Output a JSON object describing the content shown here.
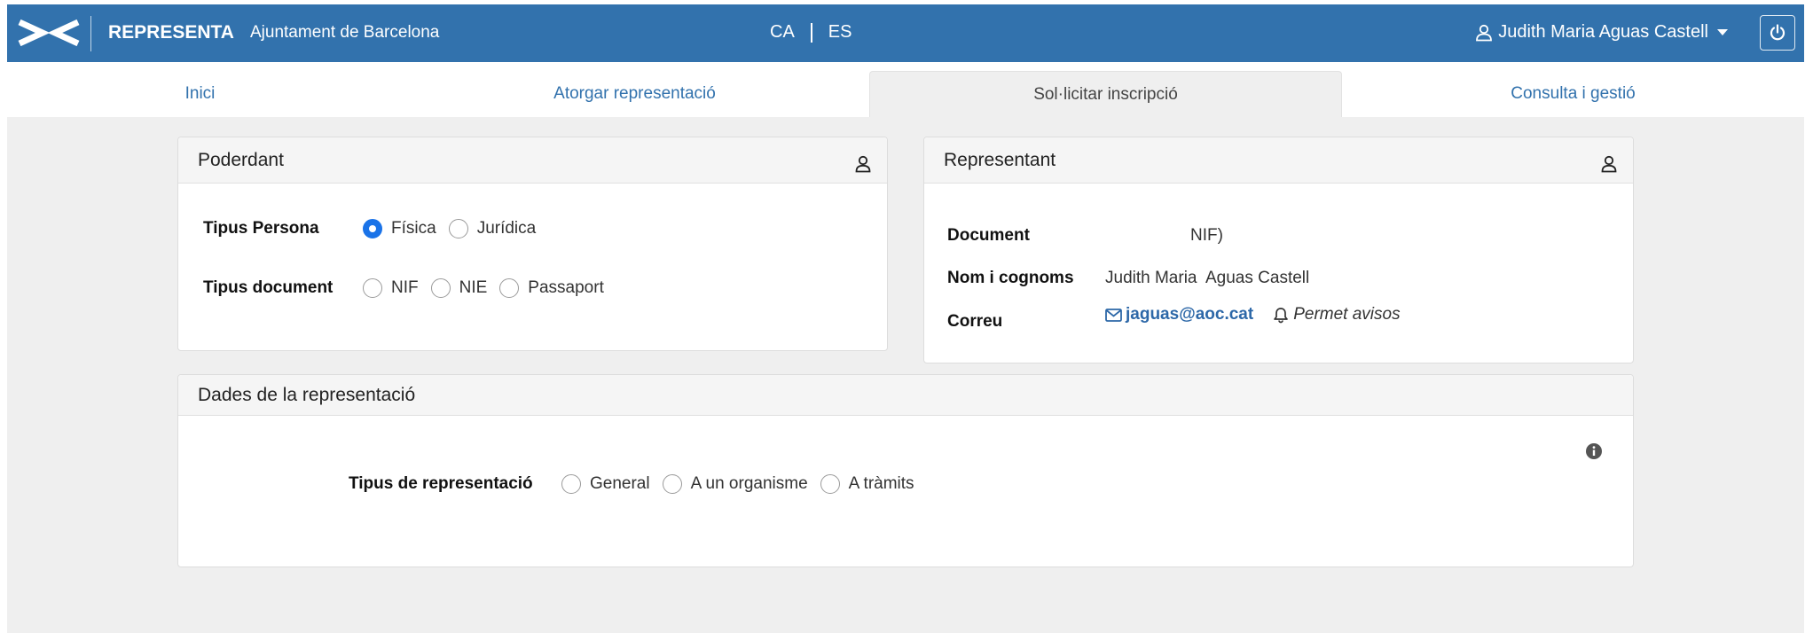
{
  "header": {
    "app_name": "REPRESENTA",
    "organization": "Ajuntament de Barcelona",
    "languages": [
      "CA",
      "ES"
    ],
    "user_name": "Judith Maria Aguas Castell"
  },
  "tabs": [
    {
      "label": "Inici"
    },
    {
      "label": "Atorgar representació"
    },
    {
      "label": "Sol·licitar inscripció"
    },
    {
      "label": "Consulta i gestió"
    }
  ],
  "poderdant": {
    "title": "Poderdant",
    "tipus_persona_label": "Tipus Persona",
    "tipus_persona_options": [
      "Física",
      "Jurídica"
    ],
    "tipus_persona_selected": "Física",
    "tipus_document_label": "Tipus document",
    "tipus_document_options": [
      "NIF",
      "NIE",
      "Passaport"
    ]
  },
  "representant": {
    "title": "Representant",
    "document_label": "Document",
    "document_value": "NIF)",
    "nom_label": "Nom i cognoms",
    "nom_value": "Judith Maria  Aguas Castell",
    "correu_label": "Correu",
    "email": "jaguas@aoc.cat",
    "permet_avisos": "Permet avisos"
  },
  "dades": {
    "title": "Dades de la representació",
    "tipus_label": "Tipus de representació",
    "tipus_options": [
      "General",
      "A un organisme",
      "A tràmits"
    ]
  },
  "colors": {
    "topbar": "#3272ad",
    "link": "#3272ad",
    "radio_checked": "#1a73e8",
    "background": "#efefef"
  },
  "icons": {
    "logo": "representa-logo",
    "user": "user-icon",
    "caret": "caret-down-icon",
    "power": "power-icon",
    "person_card": "person-icon",
    "mail": "mail-icon",
    "bell": "bell-icon",
    "info": "info-icon"
  }
}
